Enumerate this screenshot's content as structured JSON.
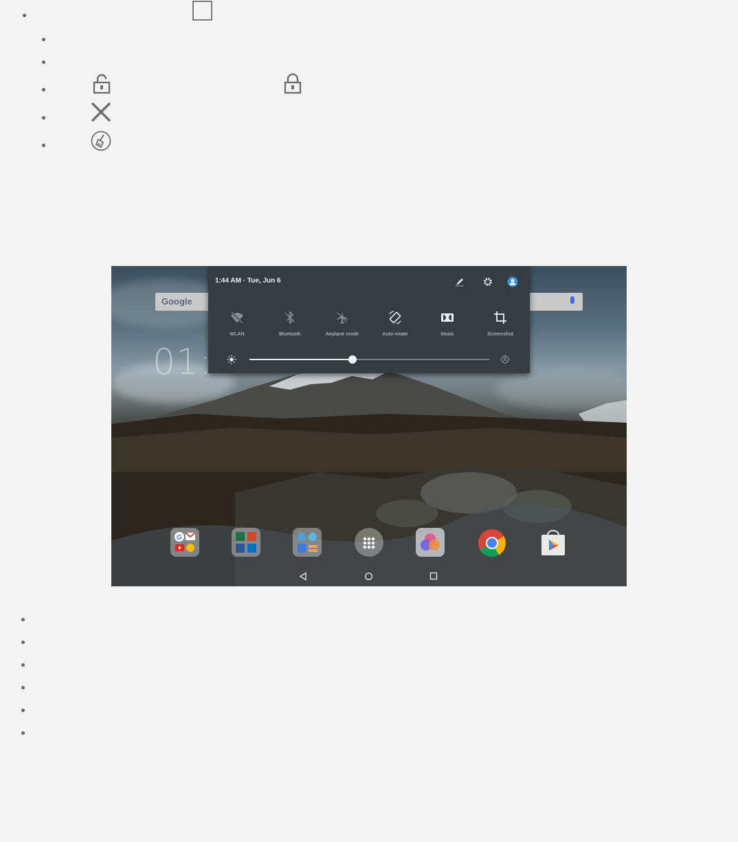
{
  "quick_settings": {
    "time_date": "1:44 AM · Tue, Jun 6",
    "tiles": [
      {
        "label": "WLAN",
        "icon": "wifi-off-icon"
      },
      {
        "label": "Bluetooth",
        "icon": "bluetooth-off-icon"
      },
      {
        "label": "Airplane mode",
        "icon": "airplane-icon"
      },
      {
        "label": "Auto-rotate",
        "icon": "auto-rotate-icon"
      },
      {
        "label": "Music",
        "icon": "dolby-icon"
      },
      {
        "label": "Screenshot",
        "icon": "crop-icon"
      }
    ],
    "brightness": 0.43
  },
  "home": {
    "search_brand": "Google",
    "clock": "01:"
  },
  "dock": [
    "google-apps-folder",
    "office-folder",
    "tools-folder",
    "all-apps",
    "gallery-app",
    "chrome-app",
    "play-store-app"
  ],
  "colors": {
    "panel": "#353d42",
    "page_bg": "#f3f3f3"
  }
}
